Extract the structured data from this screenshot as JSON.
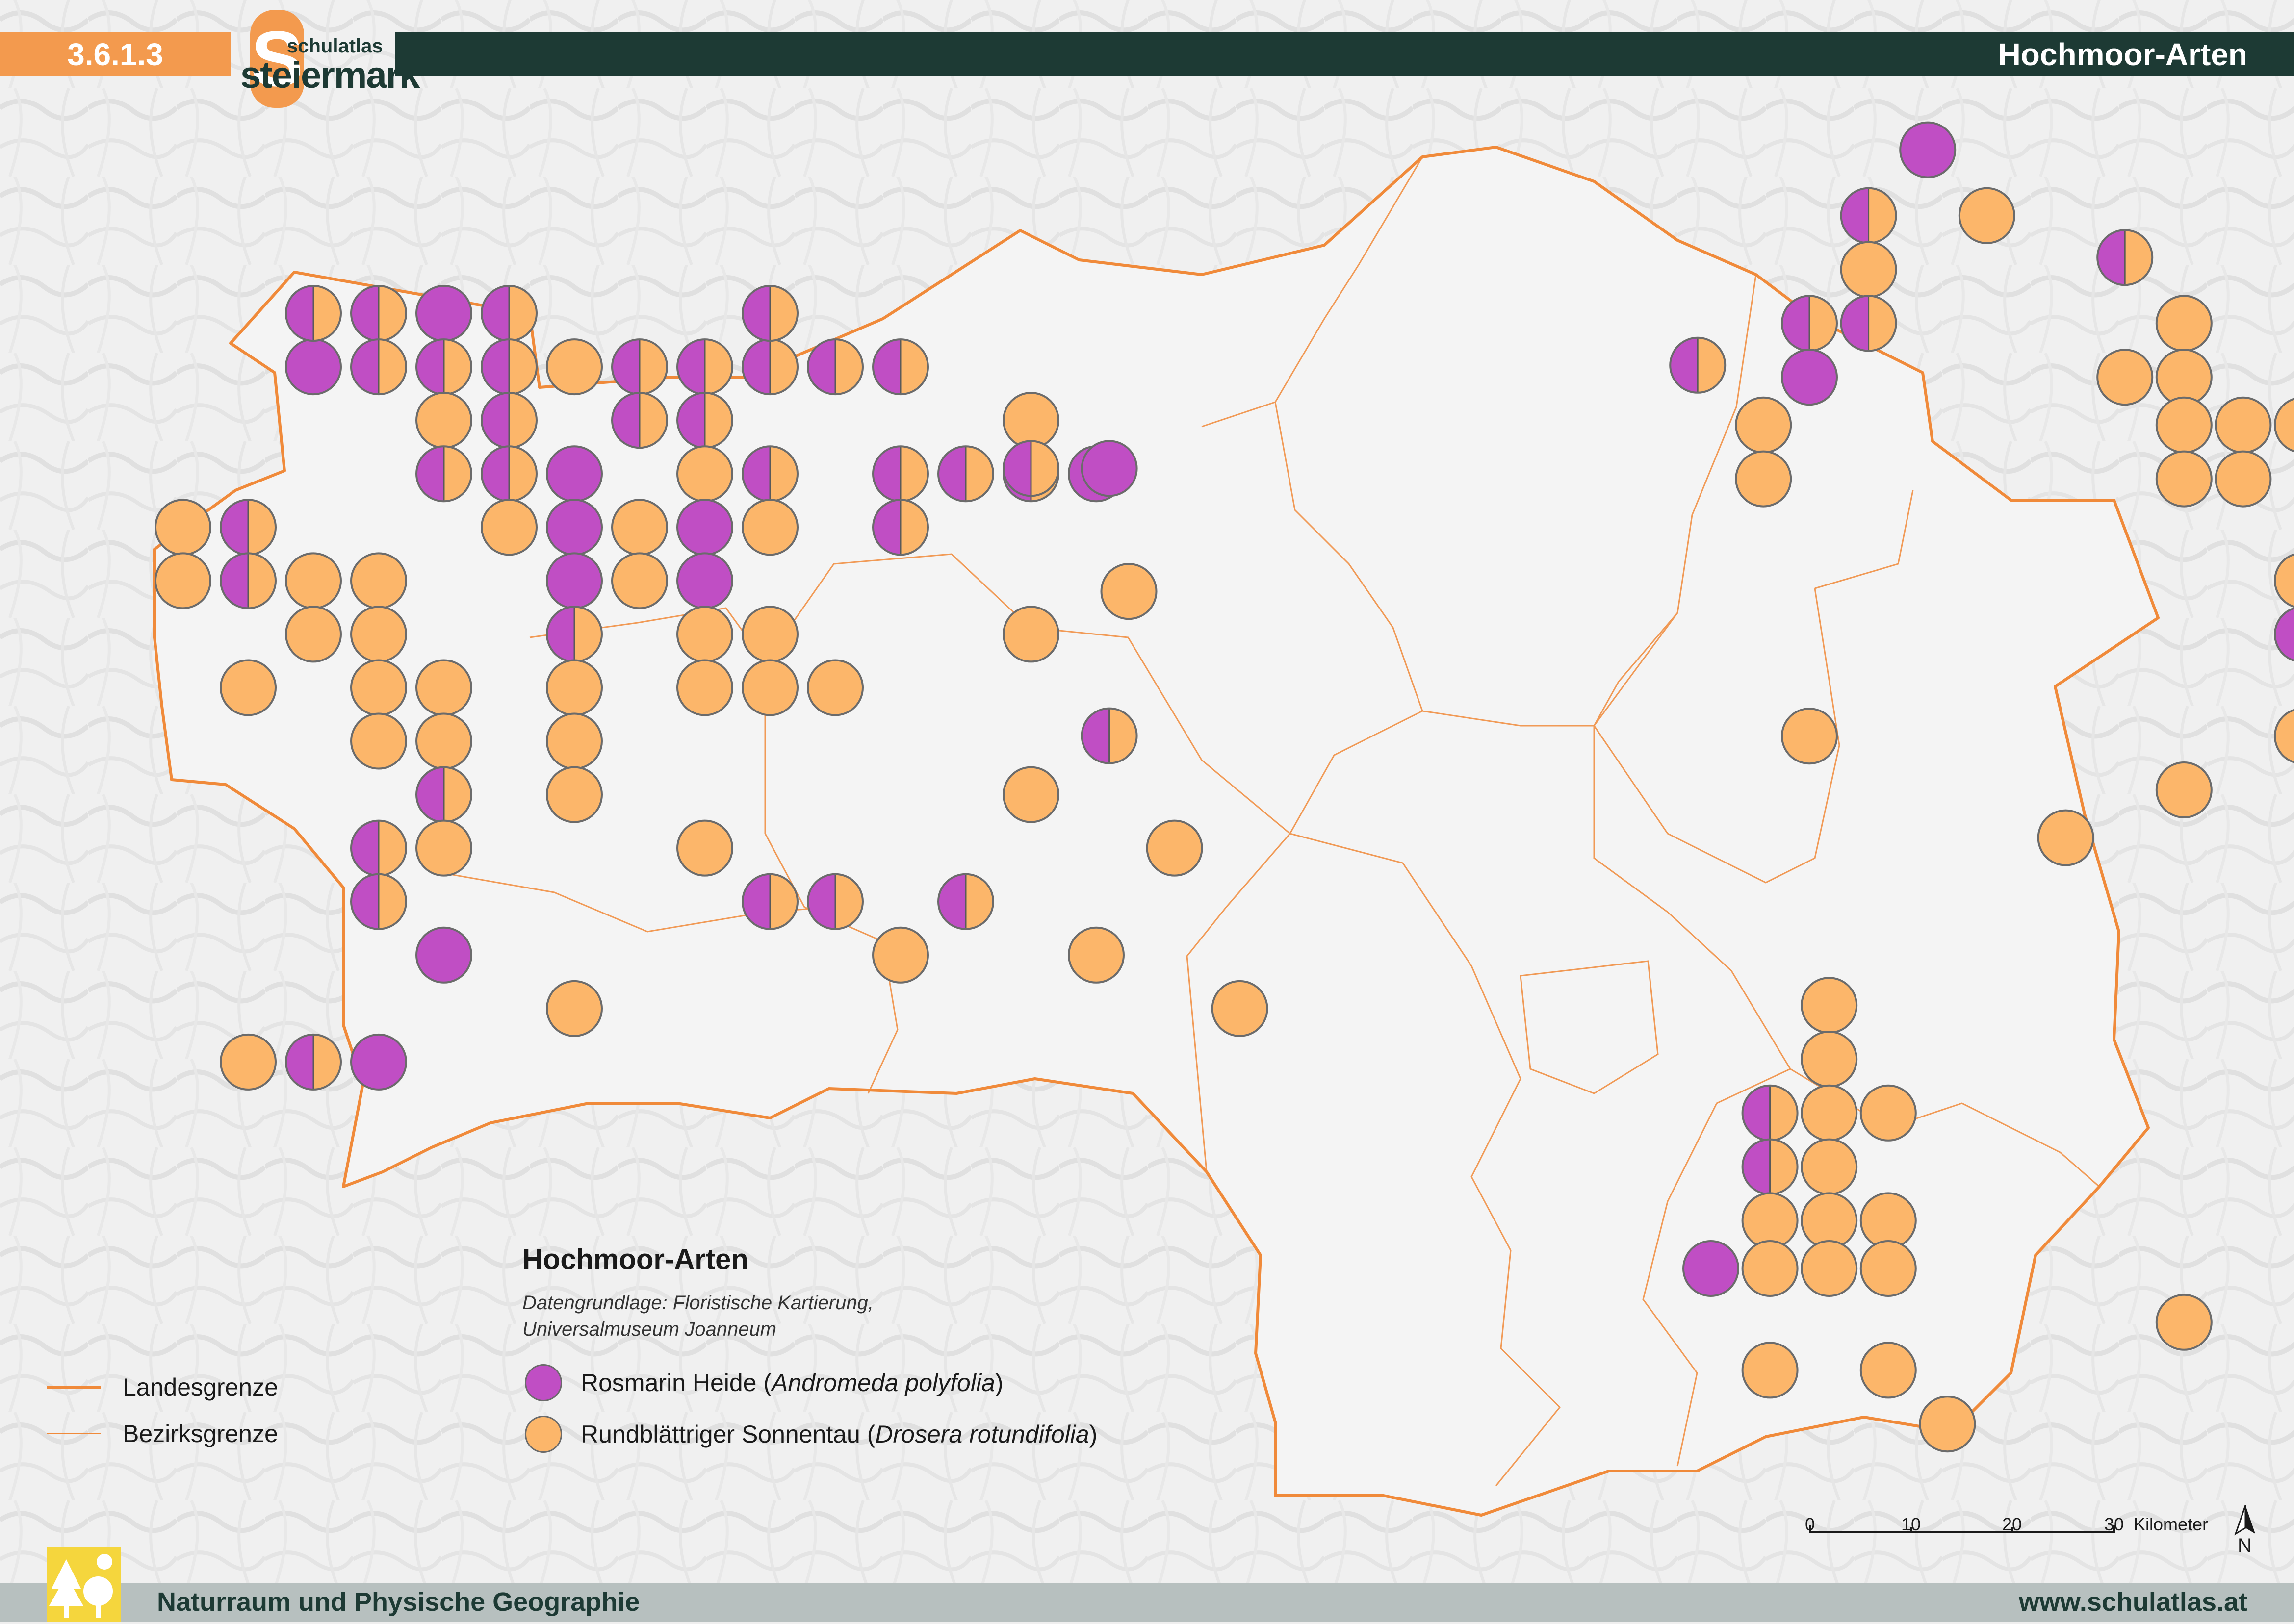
{
  "header": {
    "section_number": "3.6.1.3",
    "title": "Hochmoor-Arten",
    "logo_top": "schulatlas",
    "logo_main": "steiermark",
    "logo_letter": "S"
  },
  "legend": {
    "title": "Hochmoor-Arten",
    "source_line1": "Datengrundlage: Floristische Kartierung,",
    "source_line2": "Universalmuseum Joanneum",
    "species": [
      {
        "name": "Rosmarin Heide",
        "latin": "Andromeda polyfolia",
        "close": ")",
        "color": "#c04ec4"
      },
      {
        "name": "Rundblättriger Sonnentau",
        "latin": "Drosera rotundifolia",
        "close": ")",
        "color": "#fcb66a"
      }
    ],
    "borders": [
      {
        "label": "Landesgrenze",
        "color": "#f08a3a"
      },
      {
        "label": "Bezirksgrenze",
        "color": "#f08a3a"
      }
    ]
  },
  "scale": {
    "ticks": [
      "0",
      "10",
      "20",
      "30"
    ],
    "unit": "Kilometer",
    "north": "N"
  },
  "footer": {
    "left": "Naturraum und Physische Geographie",
    "right": "www.schulatlas.at"
  },
  "colors": {
    "andromeda": "#c04ec4",
    "drosera": "#fcb66a",
    "border": "#f08a3a",
    "dark": "#1d3a34",
    "accent": "#f39a4e"
  },
  "map": {
    "legend_codes": {
      "A": "Rosmarin Heide",
      "D": "Rundblättriger Sonnentau",
      "H": "beide Arten"
    },
    "occurrences": [
      [
        "A",
        2,
        2
      ],
      [
        "H",
        2,
        1
      ],
      [
        "H",
        3,
        1
      ],
      [
        "A",
        4,
        1
      ],
      [
        "H",
        5,
        1
      ],
      [
        "H",
        3,
        2
      ],
      [
        "H",
        4,
        2
      ],
      [
        "H",
        5,
        2
      ],
      [
        "D",
        6,
        2
      ],
      [
        "H",
        7,
        2
      ],
      [
        "H",
        8,
        2
      ],
      [
        "H",
        9,
        2
      ],
      [
        "H",
        10,
        2
      ],
      [
        "H",
        11,
        2
      ],
      [
        "H",
        9,
        1
      ],
      [
        "D",
        4,
        3
      ],
      [
        "H",
        5,
        3
      ],
      [
        "H",
        7,
        3
      ],
      [
        "H",
        8,
        3
      ],
      [
        "H",
        4,
        4
      ],
      [
        "H",
        5,
        4
      ],
      [
        "A",
        6,
        4
      ],
      [
        "D",
        8,
        4
      ],
      [
        "H",
        9,
        4
      ],
      [
        "H",
        11,
        4
      ],
      [
        "H",
        12,
        4
      ],
      [
        "H",
        13,
        4
      ],
      [
        "A",
        14,
        4
      ],
      [
        "H",
        11,
        5
      ],
      [
        "D",
        0,
        5
      ],
      [
        "H",
        1,
        5
      ],
      [
        "D",
        5,
        5
      ],
      [
        "A",
        6,
        5
      ],
      [
        "D",
        7,
        5
      ],
      [
        "A",
        8,
        5
      ],
      [
        "D",
        9,
        5
      ],
      [
        "D",
        0,
        6
      ],
      [
        "H",
        1,
        6
      ],
      [
        "D",
        2,
        6
      ],
      [
        "D",
        3,
        6
      ],
      [
        "A",
        6,
        6
      ],
      [
        "D",
        7,
        6
      ],
      [
        "A",
        8,
        6
      ],
      [
        "D",
        2,
        7
      ],
      [
        "D",
        3,
        7
      ],
      [
        "H",
        6,
        7
      ],
      [
        "D",
        8,
        7
      ],
      [
        "D",
        9,
        7
      ],
      [
        "D",
        1,
        8
      ],
      [
        "D",
        3,
        8
      ],
      [
        "D",
        4,
        8
      ],
      [
        "D",
        6,
        8
      ],
      [
        "D",
        8,
        8
      ],
      [
        "D",
        9,
        8
      ],
      [
        "D",
        10,
        8
      ],
      [
        "D",
        3,
        9
      ],
      [
        "D",
        4,
        9
      ],
      [
        "D",
        6,
        9
      ],
      [
        "H",
        4,
        10
      ],
      [
        "D",
        6,
        10
      ],
      [
        "H",
        3,
        11
      ],
      [
        "D",
        4,
        11
      ],
      [
        "D",
        8,
        11
      ],
      [
        "H",
        3,
        12
      ],
      [
        "H",
        9,
        12
      ],
      [
        "H",
        10,
        12
      ],
      [
        "H",
        12,
        12
      ],
      [
        "A",
        4,
        13
      ],
      [
        "D",
        11,
        13
      ],
      [
        "D",
        14,
        13
      ],
      [
        "D",
        6,
        14
      ],
      [
        "D",
        1,
        15
      ],
      [
        "H",
        2,
        15
      ],
      [
        "A",
        3,
        15
      ],
      [
        "D",
        13,
        3
      ],
      [
        "H",
        13,
        3.9
      ],
      [
        "A",
        14.2,
        3.9
      ],
      [
        "D",
        13,
        7
      ],
      [
        "D",
        14.5,
        6.2
      ],
      [
        "H",
        14.2,
        8.9
      ],
      [
        "D",
        13,
        10
      ],
      [
        "D",
        15.2,
        11
      ],
      [
        "D",
        16.2,
        14
      ]
    ],
    "occurrences_east": [
      [
        "A",
        20.3,
        -0.2
      ],
      [
        "H",
        19.4,
        0.9
      ],
      [
        "D",
        21.2,
        0.9
      ],
      [
        "D",
        19.4,
        1.8
      ],
      [
        "H",
        18.5,
        2.7
      ],
      [
        "H",
        19.4,
        2.7
      ],
      [
        "A",
        18.5,
        3.6
      ],
      [
        "H",
        16.8,
        3.4
      ],
      [
        "D",
        17.8,
        4.4
      ],
      [
        "D",
        17.8,
        5.3
      ],
      [
        "H",
        23.3,
        1.6
      ],
      [
        "D",
        24.2,
        2.7
      ],
      [
        "D",
        23.3,
        3.6
      ],
      [
        "D",
        24.2,
        3.6
      ],
      [
        "D",
        24.2,
        4.4
      ],
      [
        "D",
        25.1,
        4.4
      ],
      [
        "D",
        26.0,
        4.4
      ],
      [
        "D",
        24.2,
        5.3
      ],
      [
        "D",
        25.1,
        5.3
      ],
      [
        "D",
        26.0,
        7.0
      ],
      [
        "H",
        26.0,
        7.9
      ],
      [
        "D",
        26.0,
        9.6
      ],
      [
        "D",
        24.2,
        10.5
      ],
      [
        "D",
        18.5,
        9.6
      ],
      [
        "D",
        22.4,
        11.3
      ],
      [
        "D",
        18.8,
        14.1
      ],
      [
        "D",
        18.8,
        15.0
      ],
      [
        "H",
        17.9,
        15.9
      ],
      [
        "D",
        18.8,
        15.9
      ],
      [
        "D",
        19.7,
        15.9
      ],
      [
        "H",
        17.9,
        16.8
      ],
      [
        "D",
        18.8,
        16.8
      ],
      [
        "D",
        17.9,
        17.7
      ],
      [
        "D",
        18.8,
        17.7
      ],
      [
        "D",
        19.7,
        17.7
      ],
      [
        "A",
        17.0,
        18.5
      ],
      [
        "D",
        17.9,
        18.5
      ],
      [
        "D",
        18.8,
        18.5
      ],
      [
        "D",
        19.7,
        18.5
      ],
      [
        "D",
        24.2,
        19.4
      ],
      [
        "D",
        17.9,
        20.2
      ],
      [
        "D",
        19.7,
        20.2
      ],
      [
        "D",
        20.6,
        21.1
      ]
    ]
  }
}
